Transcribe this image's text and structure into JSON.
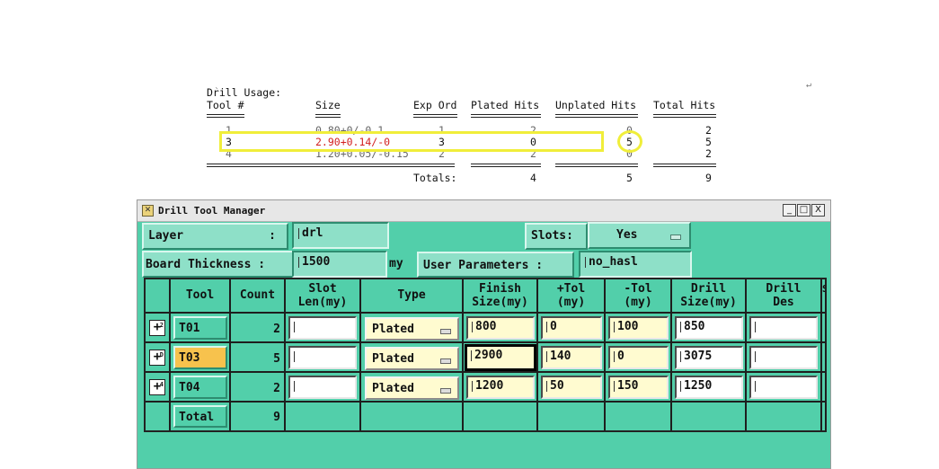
{
  "report": {
    "heading": "Drill Usage:",
    "columns": [
      "Tool #",
      "Size",
      "Exp Ord",
      "Plated Hits",
      "Unplated Hits",
      "Total Hits"
    ],
    "rows": [
      {
        "tool": "1",
        "size": "0.80+0/-0.1",
        "exp_ord": "1",
        "plated": "2",
        "unplated": "0",
        "total": "2"
      },
      {
        "tool": "3",
        "size": "2.90+0.14/-0",
        "exp_ord": "3",
        "plated": "0",
        "unplated": "5",
        "total": "5"
      },
      {
        "tool": "4",
        "size": "1.20+0.05/-0.15",
        "exp_ord": "2",
        "plated": "2",
        "unplated": "0",
        "total": "2"
      }
    ],
    "totals_label": "Totals:",
    "totals": {
      "plated": "4",
      "unplated": "5",
      "total": "9"
    },
    "highlight_color": "#f0ee3a",
    "size_highlight_color": "#d21f1f"
  },
  "window": {
    "title": "Drill Tool Manager",
    "buttons": {
      "minimize": "_",
      "maximize": "□",
      "close": "X"
    },
    "layer_label": "Layer",
    "layer_colon": ":",
    "layer_value": "drl",
    "slots_label": "Slots:",
    "slots_value": "Yes",
    "board_label": "Board Thickness :",
    "board_value": "1500",
    "board_unit": "my",
    "userparams_label": "User Parameters :",
    "userparams_value": "no_hasl"
  },
  "table": {
    "headers": {
      "tool": "Tool",
      "count": "Count",
      "slot1": "Slot",
      "slot2": "Len(my)",
      "type": "Type",
      "finish1": "Finish",
      "finish2": "Size(my)",
      "ptol1": "+Tol",
      "ptol2": "(my)",
      "mtol1": "-Tol",
      "mtol2": "(my)",
      "drill1": "Drill",
      "drill2": "Size(my)",
      "des1": "Drill",
      "des2": "Des",
      "extra": "S"
    },
    "rows": [
      {
        "tool": "T01",
        "count": "2",
        "type": "Plated",
        "finish": "800",
        "ptol": "0",
        "mtol": "100",
        "drill": "850",
        "marker": "2"
      },
      {
        "tool": "T03",
        "count": "5",
        "type": "Plated",
        "finish": "2900",
        "ptol": "140",
        "mtol": "0",
        "drill": "3075",
        "marker": "D"
      },
      {
        "tool": "T04",
        "count": "2",
        "type": "Plated",
        "finish": "1200",
        "ptol": "50",
        "mtol": "150",
        "drill": "1250",
        "marker": "4"
      }
    ],
    "total_label": "Total",
    "total_count": "9",
    "colors": {
      "bg": "#52cfaa",
      "selected_tool": "#f7c24d",
      "editable": "#fffbd0"
    }
  }
}
